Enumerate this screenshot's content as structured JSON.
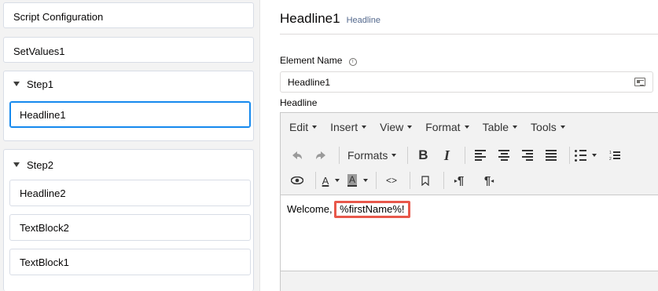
{
  "sidebar": {
    "script_configuration": "Script Configuration",
    "set_values": "SetValues1",
    "step1": {
      "label": "Step1",
      "children": [
        "Headline1"
      ]
    },
    "step2": {
      "label": "Step2",
      "children": [
        "Headline2",
        "TextBlock2",
        "TextBlock1"
      ]
    }
  },
  "main": {
    "title": "Headline1",
    "subtitle": "Headline",
    "element_name_label": "Element Name",
    "element_name_value": "Headline1",
    "headline_label": "Headline",
    "info_icon_glyph": "i"
  },
  "editor": {
    "menus": [
      "Edit",
      "Insert",
      "View",
      "Format",
      "Table",
      "Tools"
    ],
    "formats_label": "Formats",
    "bold_label": "B",
    "italic_label": "I",
    "forecolor_label": "A",
    "backcolor_label": "A",
    "code_label": "<>",
    "ltr_label": "¶",
    "rtl_label": "¶",
    "content_prefix": "Welcome, ",
    "content_token": "%firstName%!"
  },
  "colors": {
    "selected_border": "#1589ee",
    "highlight_border": "#e8584b"
  }
}
